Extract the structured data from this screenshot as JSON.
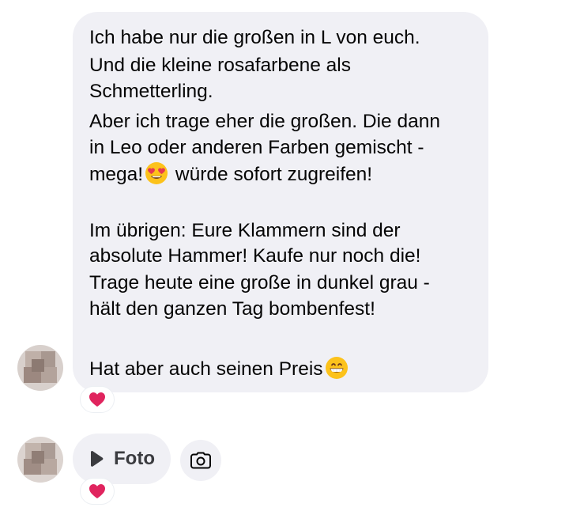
{
  "message": {
    "lines": [
      "Ich habe nur die großen in L von euch.",
      "Und die kleine rosafarbene als",
      "Schmetterling.",
      "Aber ich trage eher die großen. Die dann",
      "in Leo oder anderen Farben gemischt -",
      "mega!",
      "würde sofort zugreifen!",
      "Im übrigen: Eure Klammern sind der",
      "absolute Hammer! Kaufe nur noch die!",
      "Trage heute eine große in dunkel grau -",
      "hält den ganzen Tag bombenfest!",
      "Hat aber auch seinen Preis"
    ],
    "emoji_1": "heart-eyes-emoji",
    "emoji_2": "grinning-emoji",
    "reaction": "heart-reaction"
  },
  "attachment": {
    "label": "Foto",
    "play_icon": "play-icon",
    "camera_icon": "camera-icon",
    "reaction": "heart-reaction"
  },
  "colors": {
    "bubble": "#f0f0f5",
    "text": "#050505",
    "heart": "#e0245e"
  }
}
